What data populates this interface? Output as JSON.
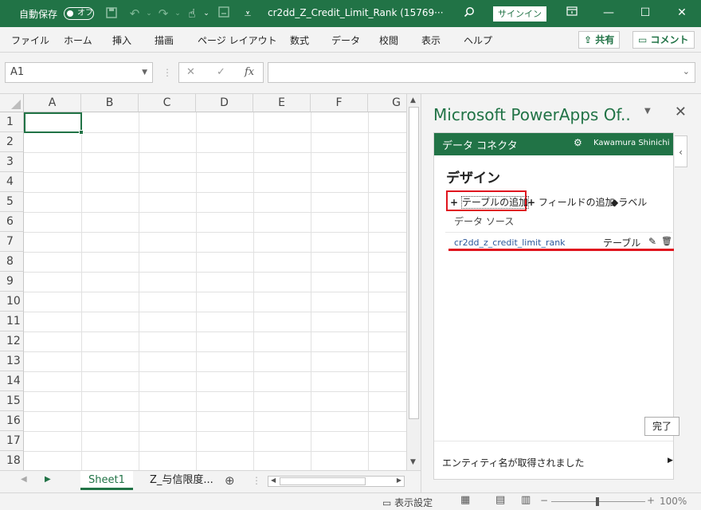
{
  "titlebar": {
    "autosave_label": "自動保存",
    "autosave_state": "オフ",
    "document_title": "cr2dd_Z_Credit_Limit_Rank (15769···",
    "signin_label": "サインイン",
    "color": "#217346"
  },
  "ribbon": {
    "tabs": [
      "ファイル",
      "ホーム",
      "挿入",
      "描画",
      "ページ レイアウト",
      "数式",
      "データ",
      "校閲",
      "表示",
      "ヘルプ"
    ],
    "share_label": "共有",
    "comment_label": "コメント"
  },
  "formula_bar": {
    "name_box": "A1",
    "fx_label": "fx",
    "formula": ""
  },
  "grid": {
    "columns": [
      "A",
      "B",
      "C",
      "D",
      "E",
      "F",
      "G"
    ],
    "rows": [
      "1",
      "2",
      "3",
      "4",
      "5",
      "6",
      "7",
      "8",
      "9",
      "10",
      "11",
      "12",
      "13",
      "14",
      "15",
      "16",
      "17",
      "18"
    ],
    "selected_cell": "A1"
  },
  "sheets": {
    "tabs": [
      "Sheet1",
      "Z_与信限度..."
    ],
    "active": "Sheet1"
  },
  "statusbar": {
    "display_settings": "表示設定",
    "zoom": "100%"
  },
  "pane": {
    "title": "Microsoft PowerApps Of..",
    "header_label": "データ コネクタ",
    "user_name": "Kawamura Shinichi",
    "section_title": "デザイン",
    "actions": {
      "add_table": "テーブルの追加",
      "add_field": "フィールドの追加",
      "label": "ラベル"
    },
    "data_source_label": "データ ソース",
    "source": {
      "name": "cr2dd_z_credit_limit_rank",
      "type": "テーブル"
    },
    "done_label": "完了",
    "footer_status": "エンティティ名が取得されました",
    "accent_color": "#217346",
    "highlight_color": "#e0141e"
  }
}
